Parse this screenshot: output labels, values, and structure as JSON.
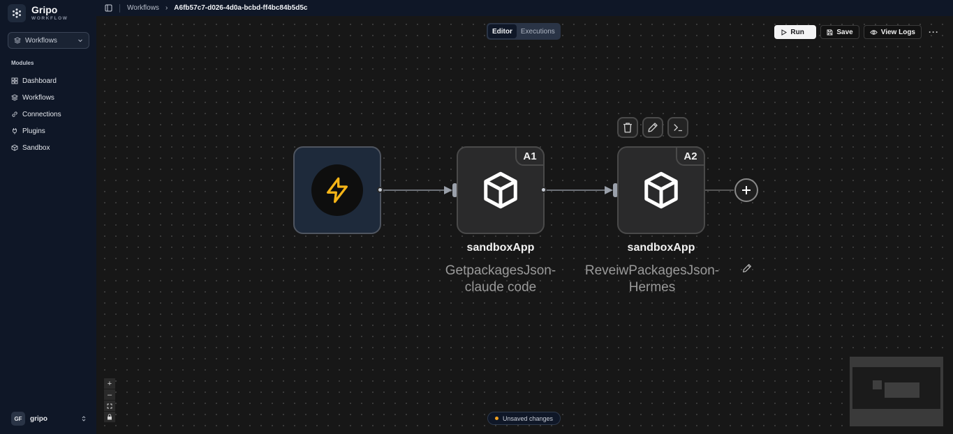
{
  "brand": {
    "name": "Gripo",
    "subtitle": "WORKFLOW"
  },
  "sidebar": {
    "selector_label": "Workflows",
    "section_label": "Modules",
    "items": [
      {
        "label": "Dashboard",
        "icon": "dashboard-icon"
      },
      {
        "label": "Workflows",
        "icon": "layers-icon"
      },
      {
        "label": "Connections",
        "icon": "link-icon"
      },
      {
        "label": "Plugins",
        "icon": "plug-icon"
      },
      {
        "label": "Sandbox",
        "icon": "cube-icon"
      }
    ],
    "user": {
      "initials": "GF",
      "name": "gripo"
    }
  },
  "breadcrumb": {
    "parent": "Workflows",
    "current": "A6fb57c7-d026-4d0a-bcbd-ff4bc84b5d5c"
  },
  "mode_tabs": {
    "editor": "Editor",
    "executions": "Executions",
    "active": "Editor"
  },
  "toolbar": {
    "run": "Run",
    "save": "Save",
    "view_logs": "View Logs",
    "more": "···"
  },
  "nodes": [
    {
      "kind": "trigger",
      "icon": "lightning-icon"
    },
    {
      "kind": "action",
      "badge": "A1",
      "title": "sandboxApp",
      "description": "GetpackagesJson-\nclaude code",
      "icon": "cube-icon"
    },
    {
      "kind": "action",
      "badge": "A2",
      "title": "sandboxApp",
      "description": "ReveiwPackagesJson-\nHermes",
      "icon": "cube-icon"
    }
  ],
  "status": {
    "unsaved": "Unsaved changes"
  },
  "colors": {
    "accent_trigger": "#f5b417",
    "unsaved_dot": "#f0a020",
    "canvas_bg": "#171717"
  }
}
